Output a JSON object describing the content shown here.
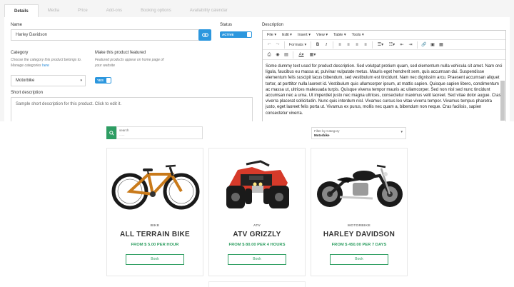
{
  "admin": {
    "tabs": [
      {
        "label": "Details",
        "active": true
      },
      {
        "label": "Media",
        "active": false
      },
      {
        "label": "Price",
        "active": false
      },
      {
        "label": "Add-ons",
        "active": false
      },
      {
        "label": "Booking options",
        "active": false
      },
      {
        "label": "Availability calendar",
        "active": false
      }
    ],
    "name_label": "Name",
    "name_value": "Harley Davidson",
    "status_label": "Status",
    "status_toggle": "ACTIVE",
    "category_label": "Category",
    "category_help": "Choose the category this product belongs to.",
    "category_help2": "Manage categories ",
    "category_help_link": "here",
    "category_value": "Motorbike",
    "featured_label": "Make this product featured",
    "featured_help": "Featured products appear on home page of",
    "featured_help2": "your website",
    "featured_toggle": "YES",
    "short_desc_label": "Short description",
    "short_desc_placeholder": "Sample short description for this product. Click to edit it.",
    "description_label": "Description",
    "editor_menu": [
      "File",
      "Edit",
      "Insert",
      "View",
      "Table",
      "Tools"
    ],
    "editor_formats": "Formats",
    "editor_text": "Some dummy text used for product description. Sed volutpat pretium quam, sed elementum nulla vehicula sit amet. Nam orci ligula, faucibus eu massa at, pulvinar vulputate metus. Mauris eget hendrerit sem, quis accumsan dui. Suspendisse elementum felis suscipit lacus bibendum, sed vestibulum est tincidunt. Nam nec dignissim arcu. Praesent accumsan aliquet tortor, at porttitor nulla laoreet id. Vestibulum quis ullamcorper ipsum, at mattis sapien. Quisque sapien libero, condimentum ac massa ut, ultrices malesuada turpis. Quisque viverra tempor mauris ac ullamcorper. Sed non nisl sed nunc tincidunt accumsan nec a urna. Ut imperdiet justo nec magna ultrices, consectetur maximus velit laoreet. Sed vitae dolor augue. Cras viverra placerat sollicitudin. Nunc quis interdum nisl. Vivamus cursus leo vitae viverra tempor. Vivamus tempus pharetra justo, eget laoreet felis porta ut. Vivamus ex purus, mollis nec quam a, bibendum non neque. Cras facilisis, sapien consectetur viverra."
  },
  "store": {
    "search_label": "search",
    "search_placeholder": "......",
    "filter_label": "Filter by Category",
    "filter_value": "Motorbike",
    "products": [
      {
        "category": "BIKE",
        "name": "ALL TERRAIN BIKE",
        "price": "FROM $ 5.00 PER HOUR",
        "book": "Book",
        "image_icon": "mountain-bike-image"
      },
      {
        "category": "ATV",
        "name": "ATV GRIZZLY",
        "price": "FROM $ 80.00 PER 4 HOURS",
        "book": "Book",
        "image_icon": "atv-quad-image"
      },
      {
        "category": "MOTORBIKE",
        "name": "HARLEY DAVIDSON",
        "price": "FROM $ 450.00 PER 7 DAYS",
        "book": "Book",
        "image_icon": "motorcycle-image"
      }
    ]
  },
  "colors": {
    "primary_blue": "#2c97de",
    "accent_green": "#32a064",
    "search_green": "#2e9d63"
  }
}
